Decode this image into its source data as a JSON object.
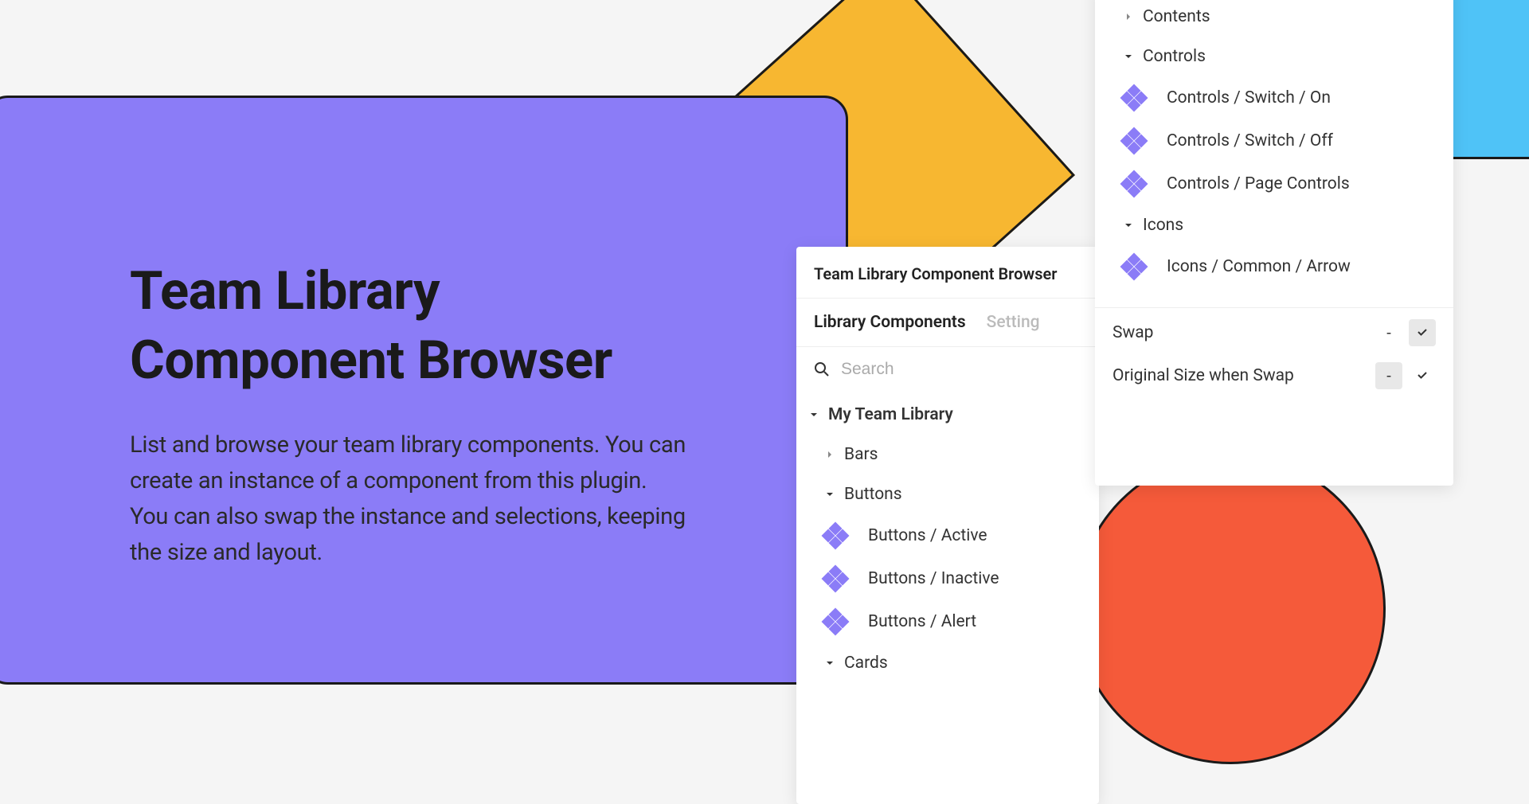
{
  "hero": {
    "title": "Team Library Component Browser",
    "description": "List and browse your team library components. You can create an instance of a component from this plugin. You can also swap the instance and selections, keeping the size and layout."
  },
  "panel_left": {
    "title": "Team Library Component Browser",
    "tabs": {
      "active": "Library Components",
      "inactive": "Setting"
    },
    "search_placeholder": "Search",
    "library_root": "My Team Library",
    "groups": {
      "bars": "Bars",
      "buttons": "Buttons",
      "cards": "Cards"
    },
    "buttons_items": [
      "Buttons / Active",
      "Buttons / Inactive",
      "Buttons / Alert"
    ]
  },
  "panel_right": {
    "groups": {
      "contents": "Contents",
      "controls": "Controls",
      "icons": "Icons"
    },
    "controls_items": [
      "Controls / Switch / On",
      "Controls / Switch / Off",
      "Controls / Page Controls"
    ],
    "icons_items": [
      "Icons / Common / Arrow"
    ],
    "options": {
      "swap": "Swap",
      "original_size": "Original Size when Swap",
      "minus": "-",
      "check": "✓"
    }
  }
}
